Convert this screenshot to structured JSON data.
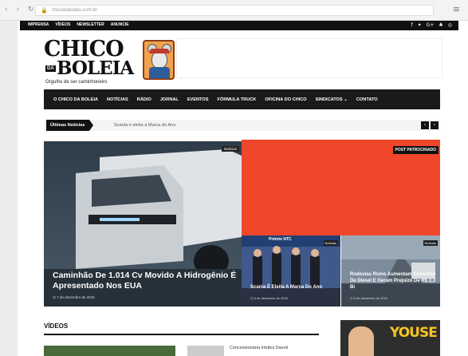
{
  "browser": {
    "url": "chicodaboleia.com.br",
    "nav_glyphs": "‹ › ↻",
    "lock_glyph": "🔒",
    "menu_glyph": "≡"
  },
  "topbar": {
    "links": [
      "IMPRENSA",
      "VÍDEOS",
      "NEWSLETTER",
      "ANUNCIE"
    ],
    "social_icons": [
      "facebook-icon",
      "twitter-icon",
      "google-plus-icon",
      "android-icon",
      "instagram-icon"
    ],
    "social_glyphs": [
      "f",
      "✦",
      "G+",
      "♣",
      "◎"
    ]
  },
  "logo": {
    "line1": "CHICO",
    "da": "DA",
    "line2": "BOLEIA",
    "tagline": "Orgulho de ser caminhoneiro"
  },
  "nav": {
    "items": [
      "O CHICO DA BOLEIA",
      "NOTÍCIAS",
      "RÁDIO",
      "JORNAL",
      "EVENTOS",
      "FÓRMULA TRUCK",
      "OFICINA DO CHICO",
      "SINDICATOS ⌄",
      "CONTATO"
    ]
  },
  "ticker": {
    "label": "Últimas Notícias",
    "headline": "Scania é eleita a Marca do Ano",
    "prev": "‹",
    "next": "›"
  },
  "featured": {
    "tag": "Notícias",
    "title": "Caminhão De 1.014 Cv Movido A Hidrogênio É Apresentado Nos EUA",
    "date": "◷ 7 de dezembro de 2016"
  },
  "promo": {
    "label": "POST PATROCINADO"
  },
  "cards": [
    {
      "tag": "Notícias",
      "overlay": "Prêmio NTC",
      "title": "Scania É Eleita A Marca Do Ano",
      "date": "◷ 6 de dezembro de 2016"
    },
    {
      "tag": "Notícias",
      "title": "Rodovias Ruins Aumentam Consumo De Diesel E Geram Prejuízo De R$ 2,3 Bi",
      "date": "◷ 6 de dezembro de 2016"
    }
  ],
  "videos": {
    "title": "VÍDEOS",
    "item_text": "Concessionária Irmãos Davoli"
  },
  "side_ad": {
    "brand": "YOUSE"
  },
  "colors": {
    "promo_red": "#f0462a",
    "nav_black": "#1a1a1a",
    "brand_yellow": "#f7c325"
  }
}
